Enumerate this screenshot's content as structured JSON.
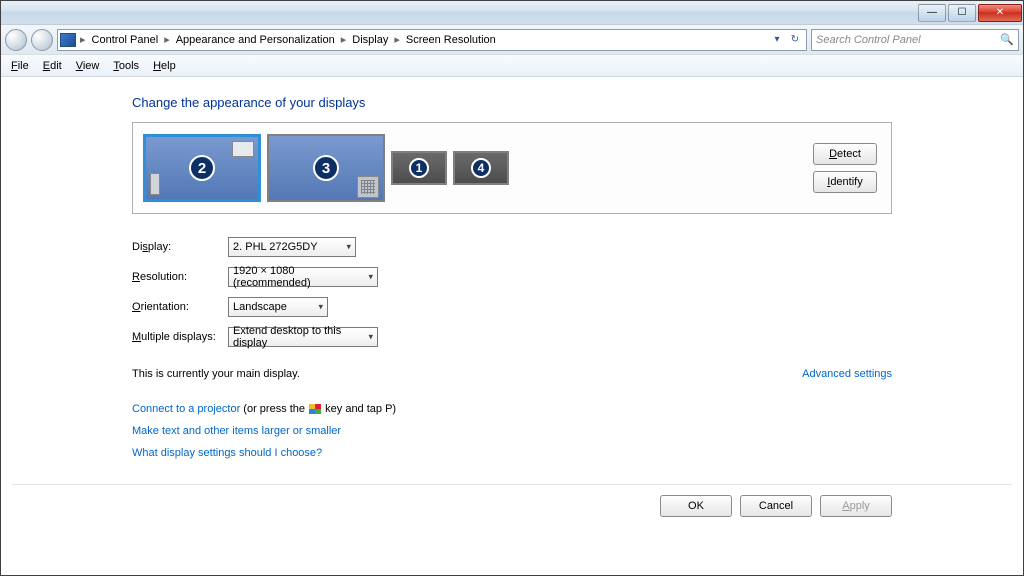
{
  "breadcrumbs": [
    "Control Panel",
    "Appearance and Personalization",
    "Display",
    "Screen Resolution"
  ],
  "search": {
    "placeholder": "Search Control Panel"
  },
  "menu": {
    "file": "File",
    "edit": "Edit",
    "view": "View",
    "tools": "Tools",
    "help": "Help"
  },
  "heading": "Change the appearance of your displays",
  "monitors": [
    {
      "num": "2",
      "primary": true,
      "taskbar": "win"
    },
    {
      "num": "3",
      "primary": false,
      "taskbar": "grid"
    },
    {
      "num": "1",
      "small": true
    },
    {
      "num": "4",
      "small": true
    }
  ],
  "buttons": {
    "detect": "Detect",
    "identify": "Identify"
  },
  "form": {
    "display_label": "Display:",
    "display_value": "2. PHL 272G5DY",
    "resolution_label": "Resolution:",
    "resolution_value": "1920 × 1080 (recommended)",
    "orientation_label": "Orientation:",
    "orientation_value": "Landscape",
    "multi_label": "Multiple displays:",
    "multi_value": "Extend desktop to this display"
  },
  "main_display_text": "This is currently your main display.",
  "advanced_link": "Advanced settings",
  "projector_link": "Connect to a projector",
  "projector_suffix_a": " (or press the ",
  "projector_suffix_b": " key and tap P)",
  "text_larger_link": "Make text and other items larger or smaller",
  "which_settings_link": "What display settings should I choose?",
  "footer": {
    "ok": "OK",
    "cancel": "Cancel",
    "apply": "Apply"
  }
}
